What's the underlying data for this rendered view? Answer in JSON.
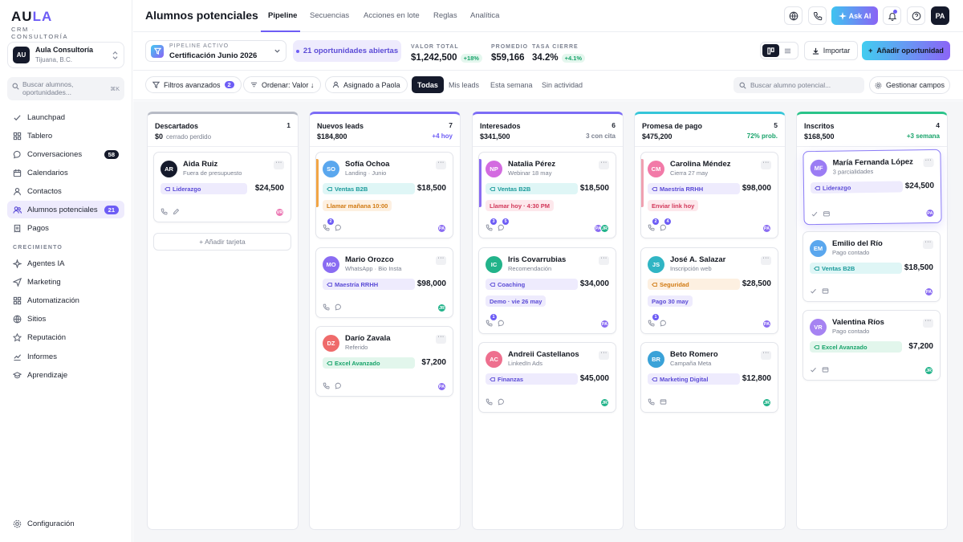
{
  "brand": {
    "logo_a": "AU",
    "logo_b": "LA",
    "tagline": "CRM · CONSULTORÍA"
  },
  "org": {
    "initials": "AU",
    "name": "Aula Consultoría",
    "location": "Tijuana, B.C."
  },
  "sidebar": {
    "search_placeholder": "Buscar alumnos, oportunidades...",
    "search_shortcut": "⌘K",
    "items": [
      {
        "label": "Launchpad",
        "icon": "check-icon"
      },
      {
        "label": "Tablero",
        "icon": "grid-icon"
      },
      {
        "label": "Conversaciones",
        "icon": "chat-icon",
        "badge": "58"
      },
      {
        "label": "Calendarios",
        "icon": "calendar-icon"
      },
      {
        "label": "Contactos",
        "icon": "person-icon"
      },
      {
        "label": "Alumnos potenciales",
        "icon": "users-icon",
        "badge": "21"
      },
      {
        "label": "Pagos",
        "icon": "receipt-icon"
      }
    ],
    "section_label": "CRECIMIENTO",
    "growth_items": [
      {
        "label": "Agentes IA",
        "icon": "sparkle-icon"
      },
      {
        "label": "Marketing",
        "icon": "send-icon"
      },
      {
        "label": "Automatización",
        "icon": "automation-icon"
      },
      {
        "label": "Sitios",
        "icon": "globe-icon"
      },
      {
        "label": "Reputación",
        "icon": "star-icon"
      },
      {
        "label": "Informes",
        "icon": "chart-icon"
      },
      {
        "label": "Aprendizaje",
        "icon": "graduation-icon"
      }
    ],
    "settings_label": "Configuración"
  },
  "header": {
    "title": "Alumnos potenciales",
    "tabs": [
      "Pipeline",
      "Secuencias",
      "Acciones en lote",
      "Reglas",
      "Analítica"
    ],
    "ask_ai": "Ask AI",
    "user_initials": "PA"
  },
  "pipeline": {
    "label": "PIPELINE ACTIVO",
    "name": "Certificación Junio 2026",
    "open_badge": "21 oportunidades abiertas",
    "stats": [
      {
        "label": "VALOR TOTAL",
        "value": "$1,242,500",
        "delta": "+18%"
      },
      {
        "label": "PROMEDIO",
        "value": "$59,166",
        "delta": ""
      },
      {
        "label": "TASA CIERRE",
        "value": "34.2%",
        "delta": "+4.1%"
      }
    ],
    "import_label": "Importar",
    "add_label": "Añadir oportunidad"
  },
  "filters": {
    "advanced": "Filtros avanzados",
    "advanced_count": "2",
    "order": "Ordenar: Valor ↓",
    "assigned": "Asignado a Paola",
    "chips": [
      "Todas",
      "Mis leads",
      "Esta semana",
      "Sin actividad"
    ],
    "search_placeholder": "Buscar alumno potencial...",
    "manage_fields": "Gestionar campos"
  },
  "columns": [
    {
      "name": "Descartados",
      "count": "1",
      "amount": "$0",
      "sub": "cerrado perdido",
      "note": "",
      "accent": "#b8bcc6",
      "note_color": "#7b8190",
      "add_card": "+ Añadir tarjeta",
      "cards": [
        {
          "initials": "AR",
          "name": "Aida Ruiz",
          "sub": "Fuera de presupuesto",
          "tag": "Liderazgo",
          "value": "$24,500",
          "owners": [
            "VR"
          ]
        }
      ]
    },
    {
      "name": "Nuevos leads",
      "count": "7",
      "amount": "$184,800",
      "sub": "",
      "note": "+4 hoy",
      "accent": "#7c6cf6",
      "note_color": "#6d5cf5",
      "cards": [
        {
          "initials": "SO",
          "name": "Sofía Ochoa",
          "sub": "Landing · Junio",
          "tag": "Ventas B2B",
          "value": "$18,500",
          "action": "Llamar mañana 10:00",
          "badge": "2",
          "owners": [
            "PA"
          ]
        },
        {
          "initials": "MO",
          "name": "Mario Orozco",
          "sub": "WhatsApp · Bio Insta",
          "tag": "Maestría RRHH",
          "value": "$98,000",
          "owners": [
            "JR"
          ]
        },
        {
          "initials": "DZ",
          "name": "Darío Zavala",
          "sub": "Referido",
          "tag": "Excel Avanzado",
          "value": "$7,200",
          "owners": [
            "PA"
          ]
        }
      ]
    },
    {
      "name": "Interesados",
      "count": "6",
      "amount": "$341,500",
      "sub": "",
      "note": "3 con cita",
      "accent": "#7c6cf6",
      "note_color": "#7b8190",
      "cards": [
        {
          "initials": "NP",
          "name": "Natalia Pérez",
          "sub": "Webinar 18 may",
          "tag": "Ventas B2B",
          "value": "$18,500",
          "action": "Llamar hoy · 4:30 PM",
          "badge": "3",
          "badge2": "5",
          "owners": [
            "PA",
            "JR"
          ]
        },
        {
          "initials": "IC",
          "name": "Iris Covarrubias",
          "sub": "Recomendación",
          "tag": "Coaching",
          "value": "$34,000",
          "action": "Demo · vie 26 may",
          "badge": "1",
          "owners": [
            "PA"
          ]
        },
        {
          "initials": "AC",
          "name": "Andreii Castellanos",
          "sub": "LinkedIn Ads",
          "tag": "Finanzas",
          "value": "$45,000",
          "owners": [
            "JR"
          ]
        }
      ]
    },
    {
      "name": "Promesa de pago",
      "count": "5",
      "amount": "$475,200",
      "sub": "",
      "note": "72% prob.",
      "accent": "#36c6d9",
      "note_color": "#17a36a",
      "cards": [
        {
          "initials": "CM",
          "name": "Carolina Méndez",
          "sub": "Cierra 27 may",
          "tag": "Maestría RRHH",
          "value": "$98,000",
          "action": "Enviar link hoy",
          "badge": "2",
          "badge2": "4",
          "owners": [
            "PA"
          ]
        },
        {
          "initials": "JS",
          "name": "José A. Salazar",
          "sub": "Inscripción web",
          "tag": "Seguridad",
          "value": "$28,500",
          "action": "Pago 30 may",
          "badge": "1",
          "owners": [
            "PA"
          ]
        },
        {
          "initials": "BR",
          "name": "Beto Romero",
          "sub": "Campaña Meta",
          "tag": "Marketing Digital",
          "value": "$12,800",
          "owners": [
            "JR"
          ]
        }
      ]
    },
    {
      "name": "Inscritos",
      "count": "4",
      "amount": "$168,500",
      "sub": "",
      "note": "+3 semana",
      "accent": "#2bc48a",
      "note_color": "#17a36a",
      "cards": [
        {
          "initials": "MF",
          "name": "María Fernanda López",
          "sub": "3 parcialidades",
          "tag": "Liderazgo",
          "value": "$24,500",
          "owners": [
            "PA"
          ]
        },
        {
          "initials": "EM",
          "name": "Emilio del Río",
          "sub": "Pago contado",
          "tag": "Ventas B2B",
          "value": "$18,500",
          "owners": [
            "PA"
          ]
        },
        {
          "initials": "VR",
          "name": "Valentina Ríos",
          "sub": "Pago contado",
          "tag": "Excel Avanzado",
          "value": "$7,200",
          "owners": [
            "JR"
          ]
        }
      ]
    }
  ]
}
